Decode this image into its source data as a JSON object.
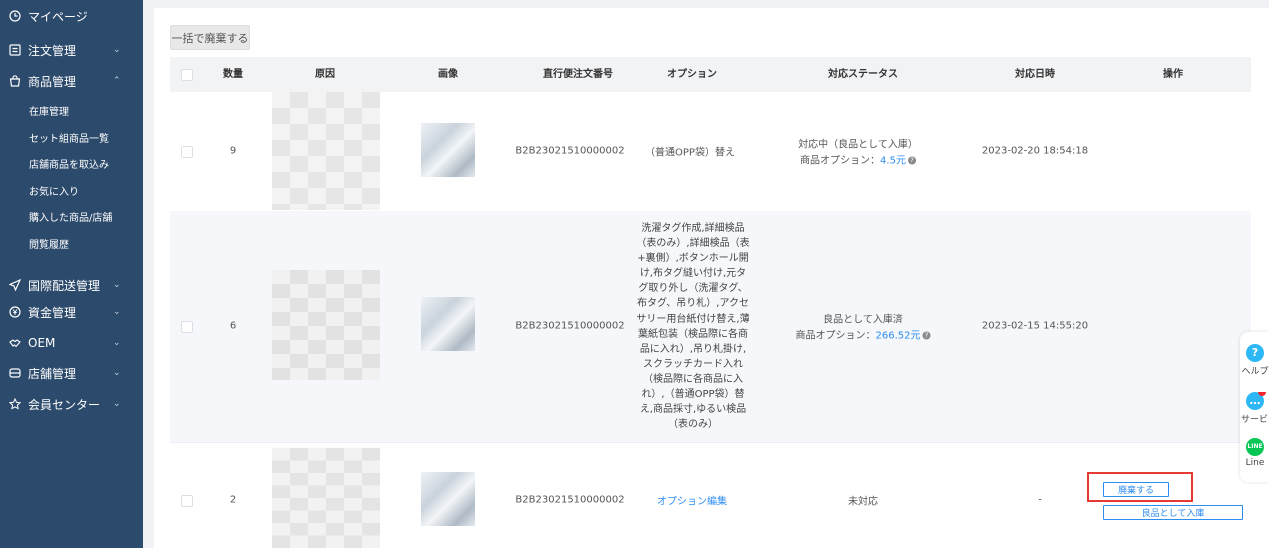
{
  "sidebar": {
    "mypage": "マイページ",
    "orders": "注文管理",
    "products": "商品管理",
    "product_sub": [
      "在庫管理",
      "セット組商品一覧",
      "店舗商品を取込み",
      "お気に入り",
      "購入した商品/店舗",
      "閲覧履歴"
    ],
    "intl_shipping": "国際配送管理",
    "funds": "資金管理",
    "oem": "OEM",
    "store": "店舗管理",
    "member": "会員センター"
  },
  "toolbar": {
    "bulk_dispose": "一括で廃棄する"
  },
  "table": {
    "headers": [
      "数量",
      "原因",
      "画像",
      "直行便注文番号",
      "オプション",
      "対応ステータス",
      "対応日時",
      "操作"
    ],
    "rows": [
      {
        "qty": "9",
        "order_no": "B2B23021510000002",
        "option": "（普通OPP袋）替え",
        "status_line1": "対応中（良品として入庫）",
        "status_line2_prefix": "商品オプション：",
        "status_amount": "4.5元",
        "date": "2023-02-20 18:54:18"
      },
      {
        "qty": "6",
        "order_no": "B2B23021510000002",
        "option_lines": [
          "洗濯タグ作成,詳細検品",
          "（表のみ）,詳細検品（表",
          "+裏側）,ボタンホール開",
          "け,布タグ縫い付け,元タ",
          "グ取り外し（洗濯タグ、",
          "布タグ、吊り札）,アクセ",
          "サリー用台紙付け替え,薄",
          "葉紙包装（検品際に各商",
          "品に入れ）,吊り札掛け,",
          "スクラッチカード入れ",
          "（検品際に各商品に入",
          "れ）,（普通OPP袋）替",
          "え,商品採寸,ゆるい検品",
          "（表のみ）"
        ],
        "status_line1": "良品として入庫済",
        "status_line2_prefix": "商品オプション：",
        "status_amount": "266.52元",
        "date": "2023-02-15 14:55:20"
      },
      {
        "qty": "2",
        "order_no": "B2B23021510000002",
        "option_link": "オプション編集",
        "status": "未対応",
        "date": "-",
        "btn_dispose": "廃棄する",
        "btn_restock": "良品として入庫"
      }
    ]
  },
  "float": {
    "help": "ヘルプ",
    "service": "サービス",
    "line": "Line"
  },
  "colors": {
    "sidebar": "#2c4a6b",
    "link": "#2d8cf0",
    "highlight": "#e53935"
  }
}
